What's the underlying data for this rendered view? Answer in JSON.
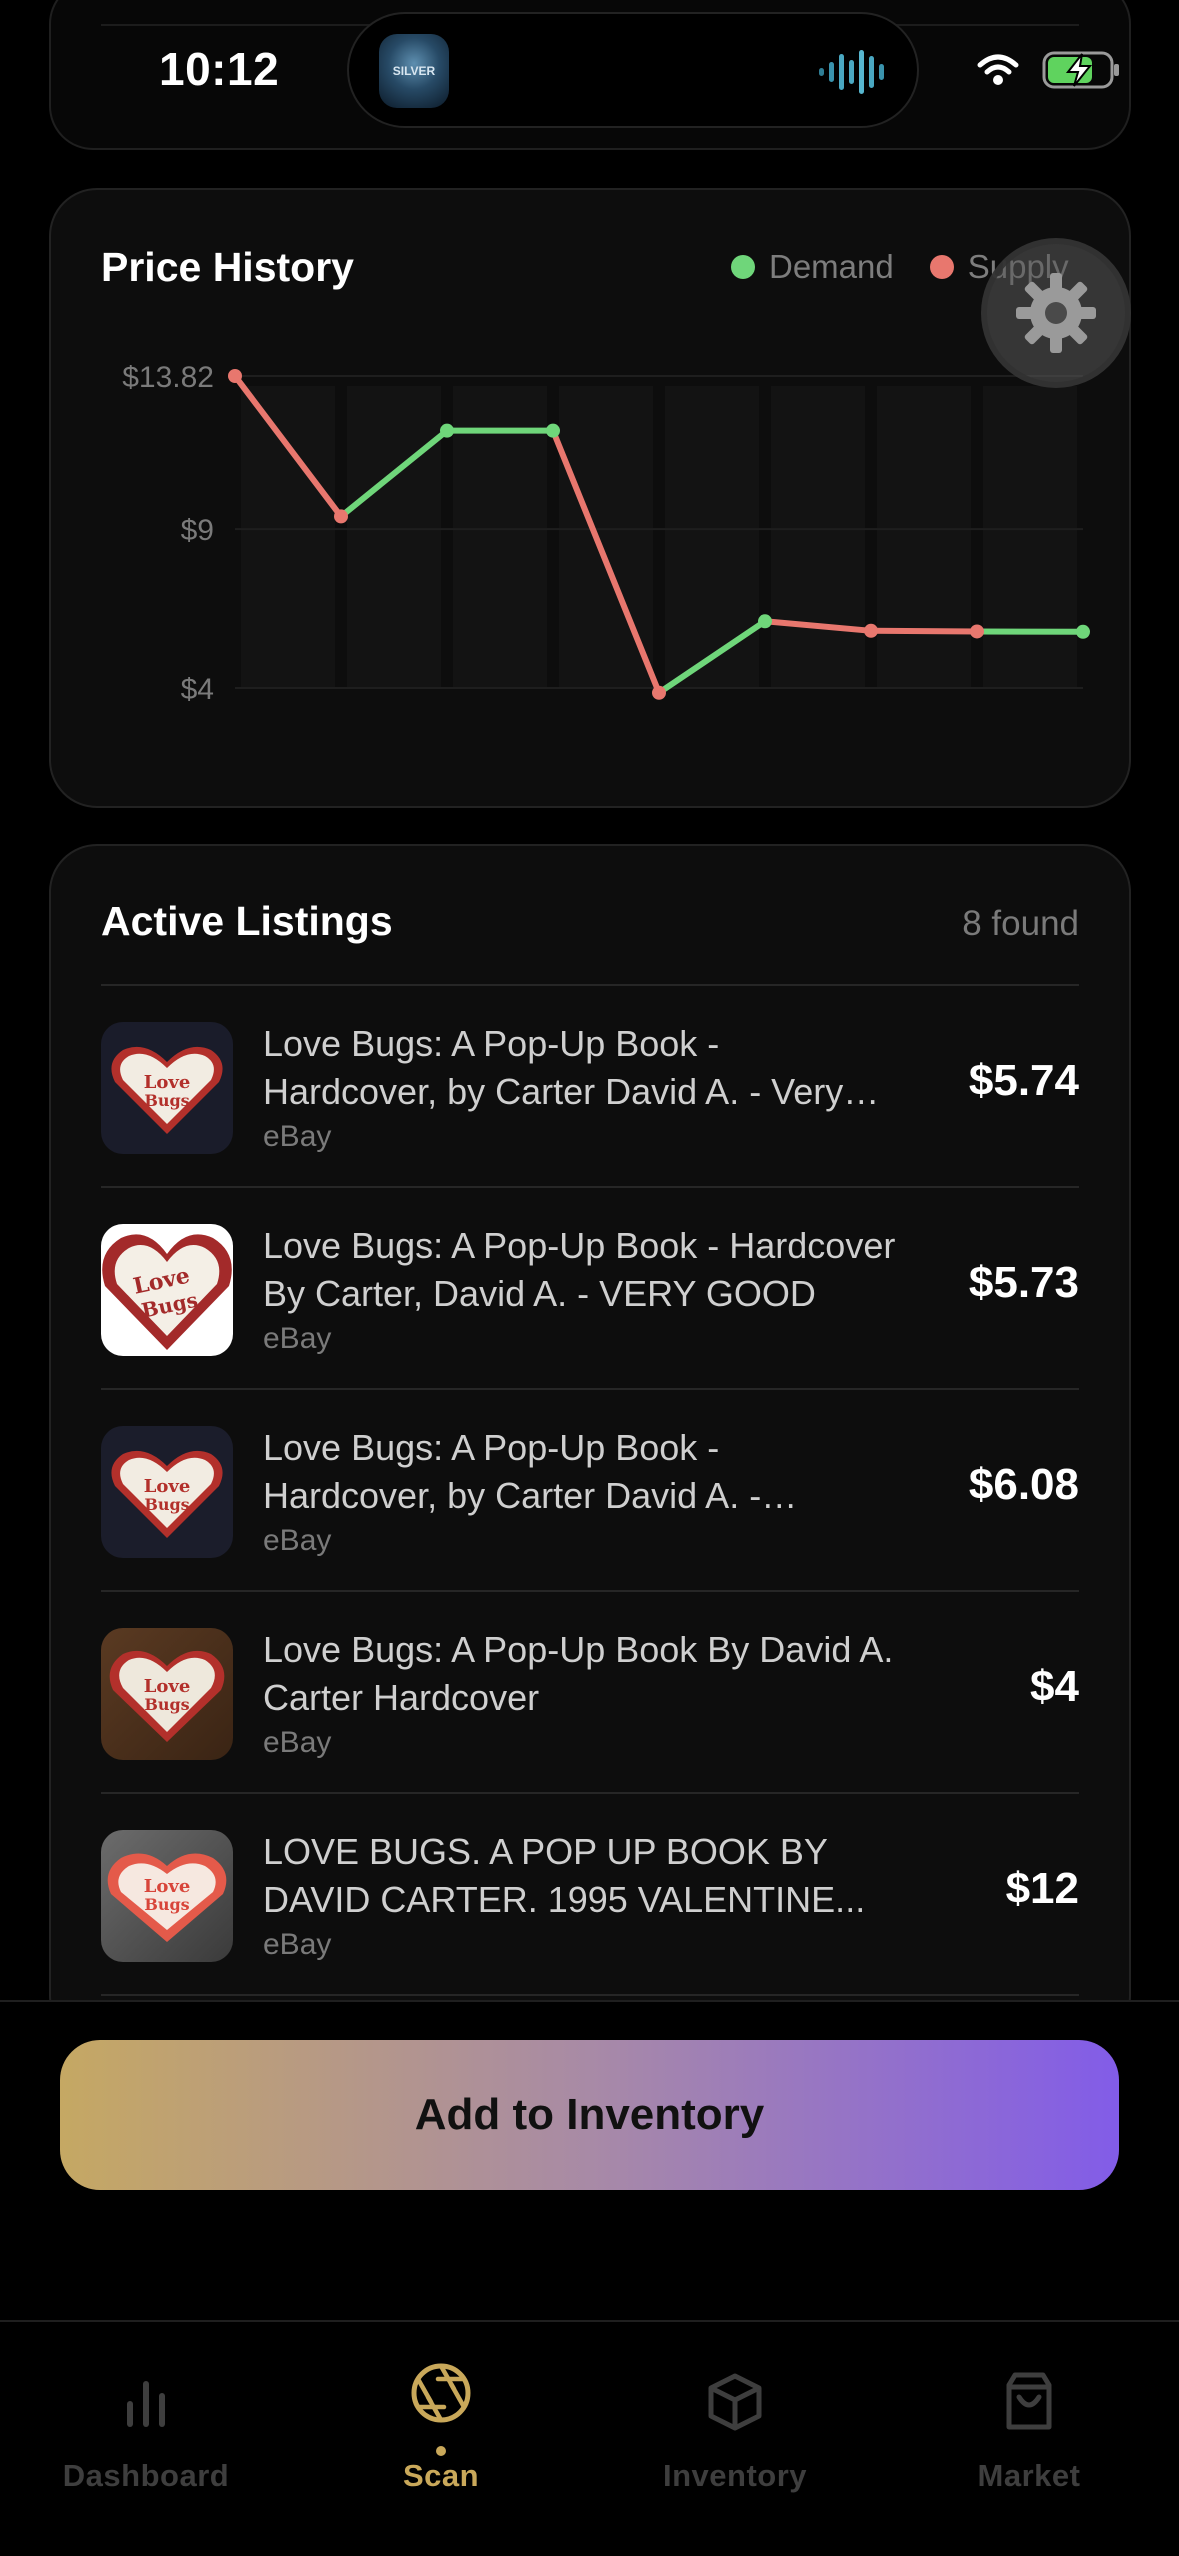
{
  "status": {
    "time": "10:12",
    "island_thumb_text": "SILVER"
  },
  "price_history": {
    "title": "Price History",
    "legend": [
      {
        "label": "Demand",
        "color": "#6fd67a"
      },
      {
        "label": "Supply",
        "color": "#e8776e"
      }
    ]
  },
  "chart_data": {
    "type": "line",
    "title": "Price History",
    "y_tick_labels": [
      "$13.82",
      "$9",
      "$4"
    ],
    "ylim": [
      4,
      13.82
    ],
    "points": [
      13.82,
      9.4,
      12.1,
      12.1,
      3.85,
      6.1,
      5.8,
      5.78,
      5.77
    ],
    "segment_colors": [
      "#e8776e",
      "#6fd67a",
      "#6fd67a",
      "#e8776e",
      "#6fd67a",
      "#e8776e",
      "#e8776e",
      "#6fd67a"
    ],
    "grid": true,
    "legend_position": "top-right"
  },
  "listings": {
    "title": "Active Listings",
    "count_label": "8 found",
    "items": [
      {
        "title": "Love Bugs: A Pop-Up Book - Hardcover, by Carter David A. - Very Good",
        "source": "eBay",
        "price": "$5.74"
      },
      {
        "title": "Love Bugs: A Pop-Up Book - Hardcover By Carter, David A. - VERY GOOD",
        "source": "eBay",
        "price": "$5.73"
      },
      {
        "title": "Love Bugs: A Pop-Up Book - Hardcover, by Carter David A. - Acceptable",
        "source": "eBay",
        "price": "$6.08"
      },
      {
        "title": "Love Bugs: A Pop-Up Book By David A. Carter Hardcover",
        "source": "eBay",
        "price": "$4"
      },
      {
        "title": "LOVE BUGS. A POP UP BOOK BY DAVID CARTER. 1995 VALENTINE...",
        "source": "eBay",
        "price": "$12"
      }
    ]
  },
  "actions": {
    "add_label": "Add to Inventory"
  },
  "tabs": [
    {
      "label": "Dashboard",
      "icon": "bar-chart-icon",
      "active": false
    },
    {
      "label": "Scan",
      "icon": "aperture-icon",
      "active": true
    },
    {
      "label": "Inventory",
      "icon": "box-icon",
      "active": false
    },
    {
      "label": "Market",
      "icon": "shopping-bag-icon",
      "active": false
    }
  ]
}
